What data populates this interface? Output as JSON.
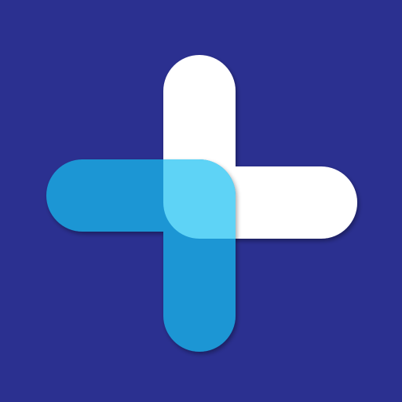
{
  "logo": {
    "name": "plus-cross-logo",
    "colors": {
      "background": "#2B3090",
      "white_bar": "#FFFFFF",
      "blue_bar": "#1E96D4",
      "overlap": "#5ED3F6",
      "shadow": "#1E2266"
    }
  }
}
